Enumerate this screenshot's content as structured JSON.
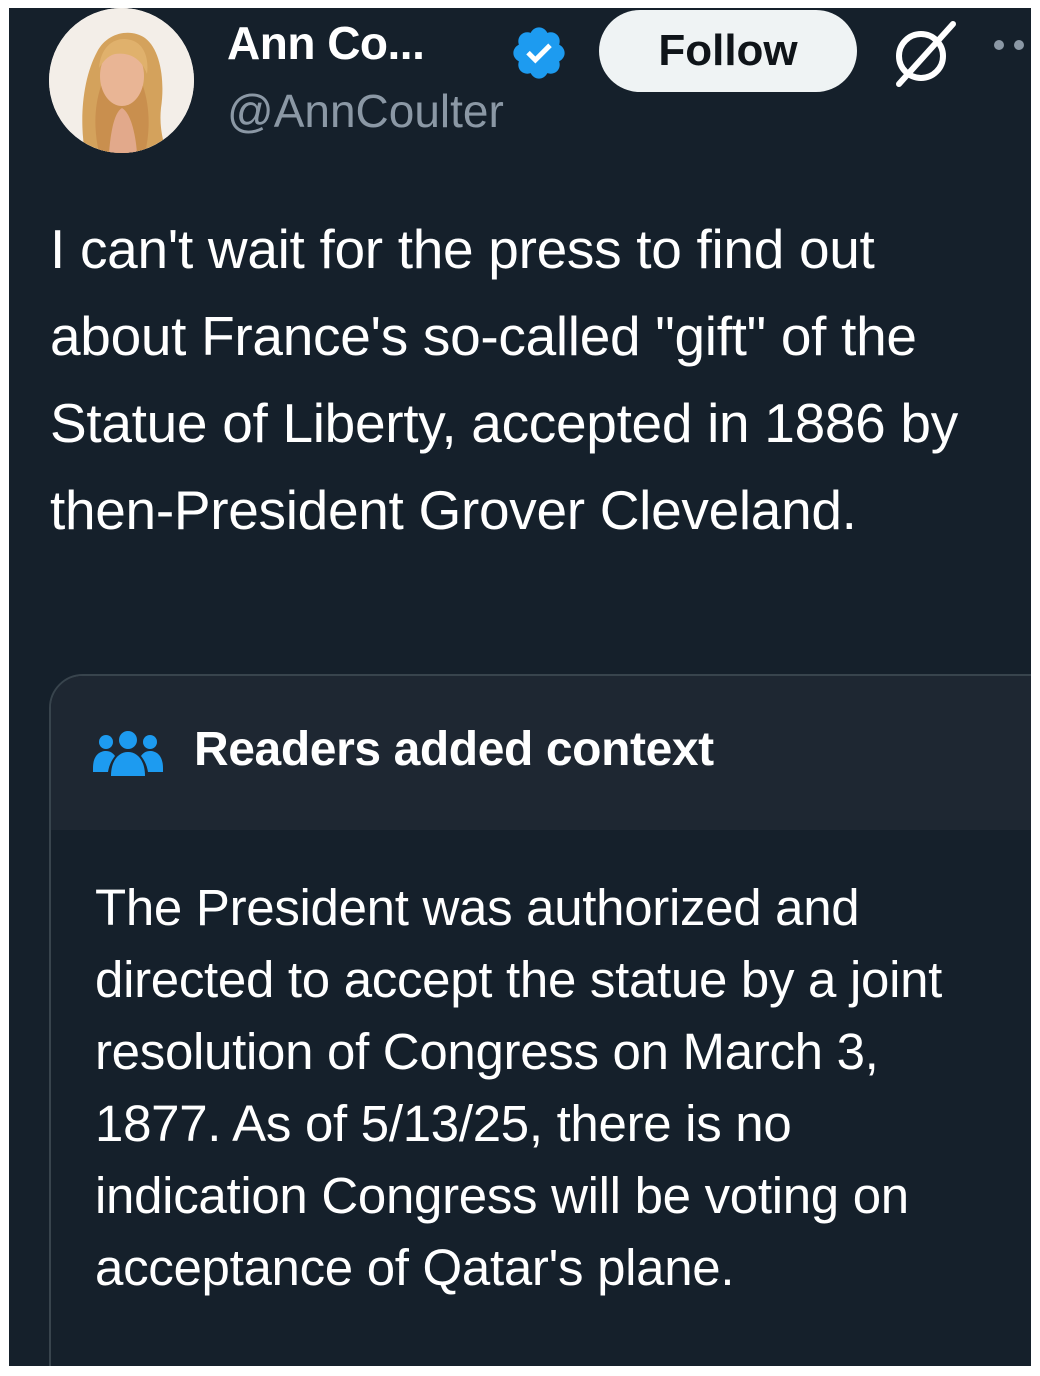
{
  "tweet": {
    "display_name": "Ann Co...",
    "handle": "@AnnCoulter",
    "follow_label": "Follow",
    "text": "I can't wait for the press to find out about France's so-called \"gift\" of the Statue of Liberty, accepted in 1886 by then-President Grover Cleveland."
  },
  "community_note": {
    "title": "Readers added context",
    "body": "The President was authorized and directed to accept the statue by a joint resolution of Congress on March 3, 1877. As of 5/13/25, there is no indication Congress will be voting on acceptance of Qatar's plane."
  },
  "icons": {
    "verified": "verified-badge-icon",
    "grok": "grok-icon",
    "more": "more-options-icon",
    "people": "people-icon"
  },
  "colors": {
    "background": "#15202b",
    "note_header": "#1e2732",
    "secondary_text": "#8b98a5",
    "verified_blue": "#1d9bf0",
    "follow_button": "#eff3f4"
  }
}
